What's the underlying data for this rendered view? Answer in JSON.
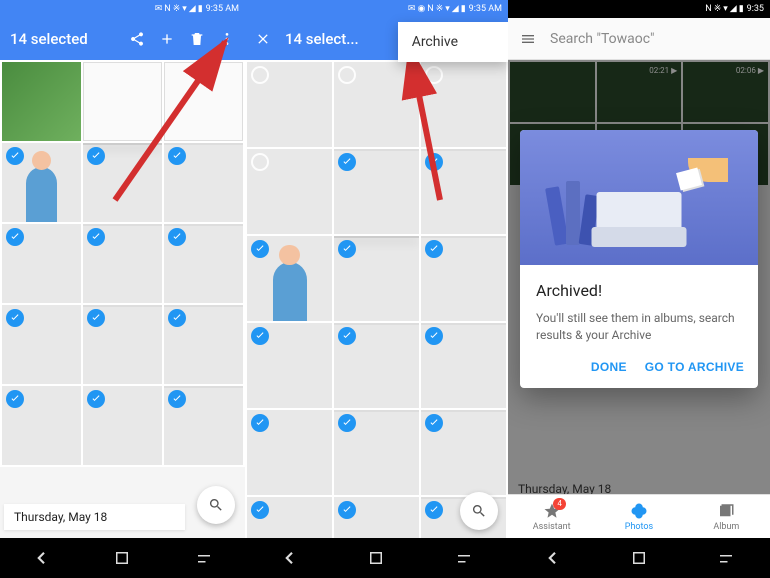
{
  "status": {
    "time": "9:35 AM",
    "time3": "9:35"
  },
  "panel1": {
    "title": "14 selected",
    "date": "Thursday, May 18"
  },
  "panel2": {
    "title": "14 select...",
    "menu": {
      "archive": "Archive"
    }
  },
  "panel3": {
    "search_placeholder": "Search \"Towaoc\"",
    "videos": [
      {
        "duration": "02:21"
      },
      {
        "duration": "02:06"
      }
    ],
    "dialog": {
      "title": "Archived!",
      "body": "You'll still see them in albums, search results & your Archive",
      "done": "DONE",
      "go": "GO TO ARCHIVE"
    },
    "date": "Thursday, May 18",
    "nav": {
      "assistant": "Assistant",
      "photos": "Photos",
      "albums": "Album",
      "badge": "4"
    }
  }
}
